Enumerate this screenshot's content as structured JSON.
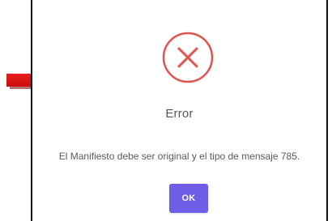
{
  "dialog": {
    "icon": "error-x-circle-icon",
    "title": "Error",
    "message": "El Manifiesto debe ser original y el tipo de mensaje 785.",
    "ok_label": "OK"
  },
  "annotation": {
    "arrow_icon": "red-right-arrow-icon"
  },
  "colors": {
    "error_red": "#e0534f",
    "button_purple": "#6f5de8",
    "text_gray": "#5a5a5a",
    "arrow_red": "#e41414"
  }
}
